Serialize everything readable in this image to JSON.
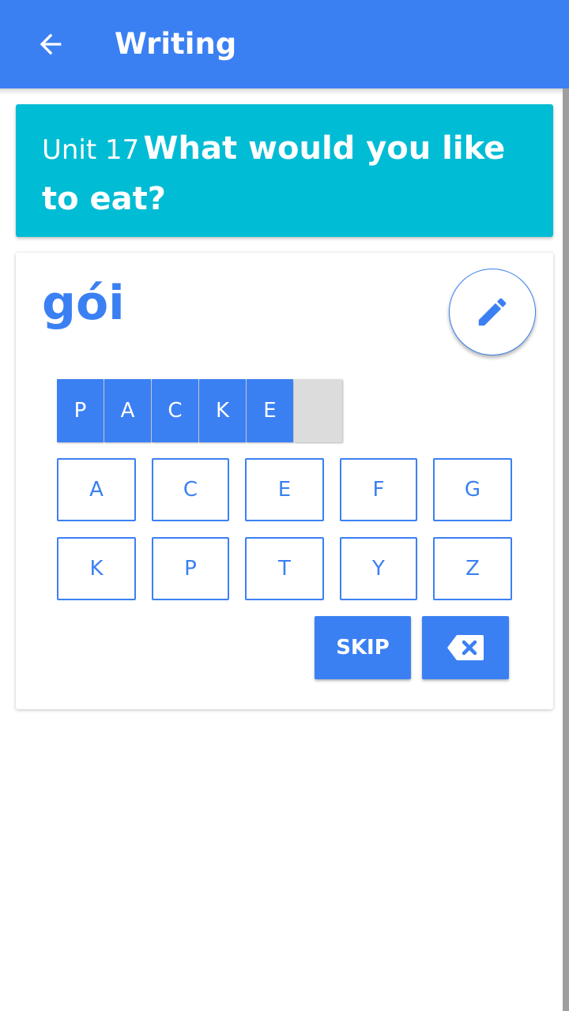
{
  "app_bar": {
    "title": "Writing",
    "back_icon": "arrow-left-icon",
    "color": "#3b80f3"
  },
  "unit": {
    "label": "Unit 17",
    "title": "What would you like to eat?",
    "color": "#00bcd4"
  },
  "exercise": {
    "word": "gói",
    "edit_icon": "pencil-icon",
    "answer_tiles": [
      "P",
      "A",
      "C",
      "K",
      "E"
    ],
    "keys_row1": [
      "A",
      "C",
      "E",
      "F",
      "G"
    ],
    "keys_row2": [
      "K",
      "P",
      "T",
      "Y",
      "Z"
    ],
    "skip_label": "SKIP",
    "backspace_icon": "backspace-icon"
  }
}
